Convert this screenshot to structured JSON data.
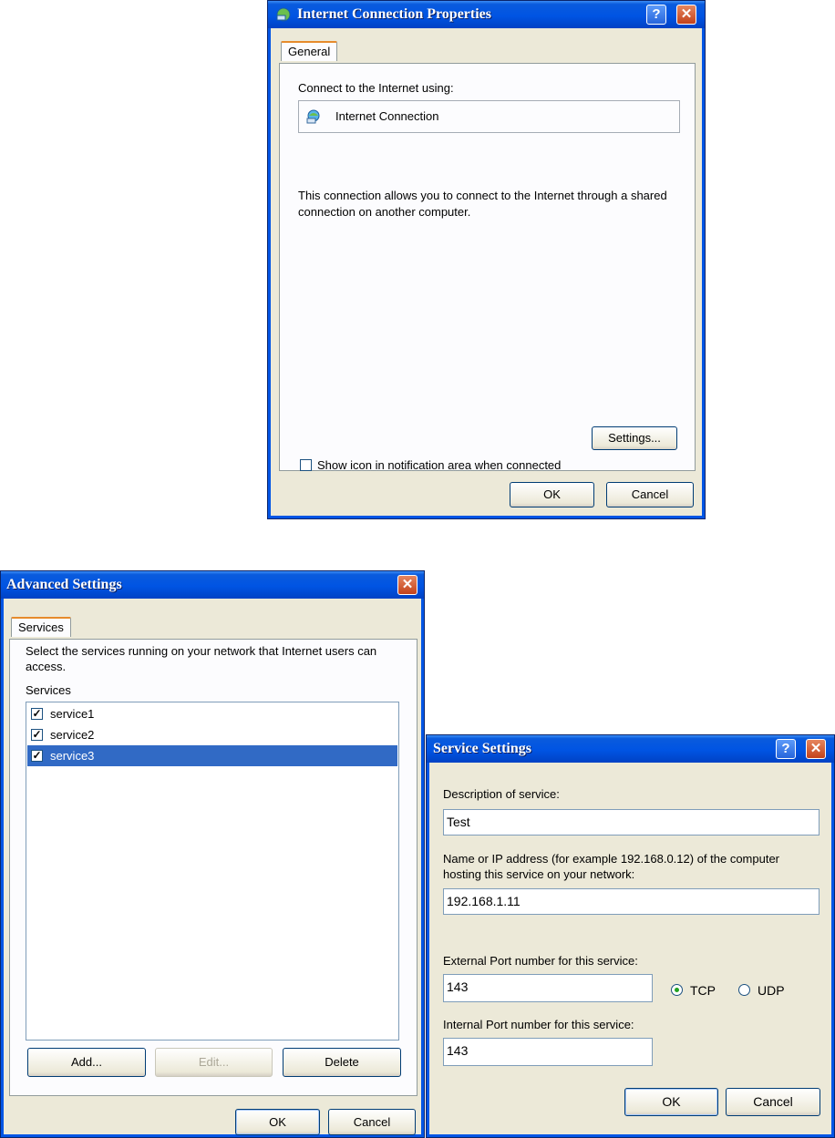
{
  "internet_dialog": {
    "title": "Internet Connection Properties",
    "tab": "General",
    "connect_using_label": "Connect to the Internet using:",
    "connection_name": "Internet Connection",
    "description": "This connection allows you to connect to the Internet through a shared connection on another computer.",
    "settings_button": "Settings...",
    "show_icon_label": "Show icon in notification area when connected",
    "show_icon_checked": false,
    "ok": "OK",
    "cancel": "Cancel"
  },
  "advanced_dialog": {
    "title": "Advanced Settings",
    "tab": "Services",
    "instructions": "Select the services running on your network that Internet users can access.",
    "services_label": "Services",
    "services": [
      {
        "name": "service1",
        "checked": true,
        "selected": false
      },
      {
        "name": "service2",
        "checked": true,
        "selected": false
      },
      {
        "name": "service3",
        "checked": true,
        "selected": true
      }
    ],
    "add": "Add...",
    "edit": "Edit...",
    "delete": "Delete",
    "ok": "OK",
    "cancel": "Cancel"
  },
  "service_dialog": {
    "title": "Service Settings",
    "description_label": "Description of service:",
    "description_value": "Test",
    "host_label": "Name or IP address (for example 192.168.0.12) of the computer hosting this service on your network:",
    "host_value": "192.168.1.11",
    "external_port_label": "External Port number for this service:",
    "external_port_value": "143",
    "protocol_tcp": "TCP",
    "protocol_udp": "UDP",
    "selected_protocol": "TCP",
    "internal_port_label": "Internal Port number for this service:",
    "internal_port_value": "143",
    "ok": "OK",
    "cancel": "Cancel"
  }
}
